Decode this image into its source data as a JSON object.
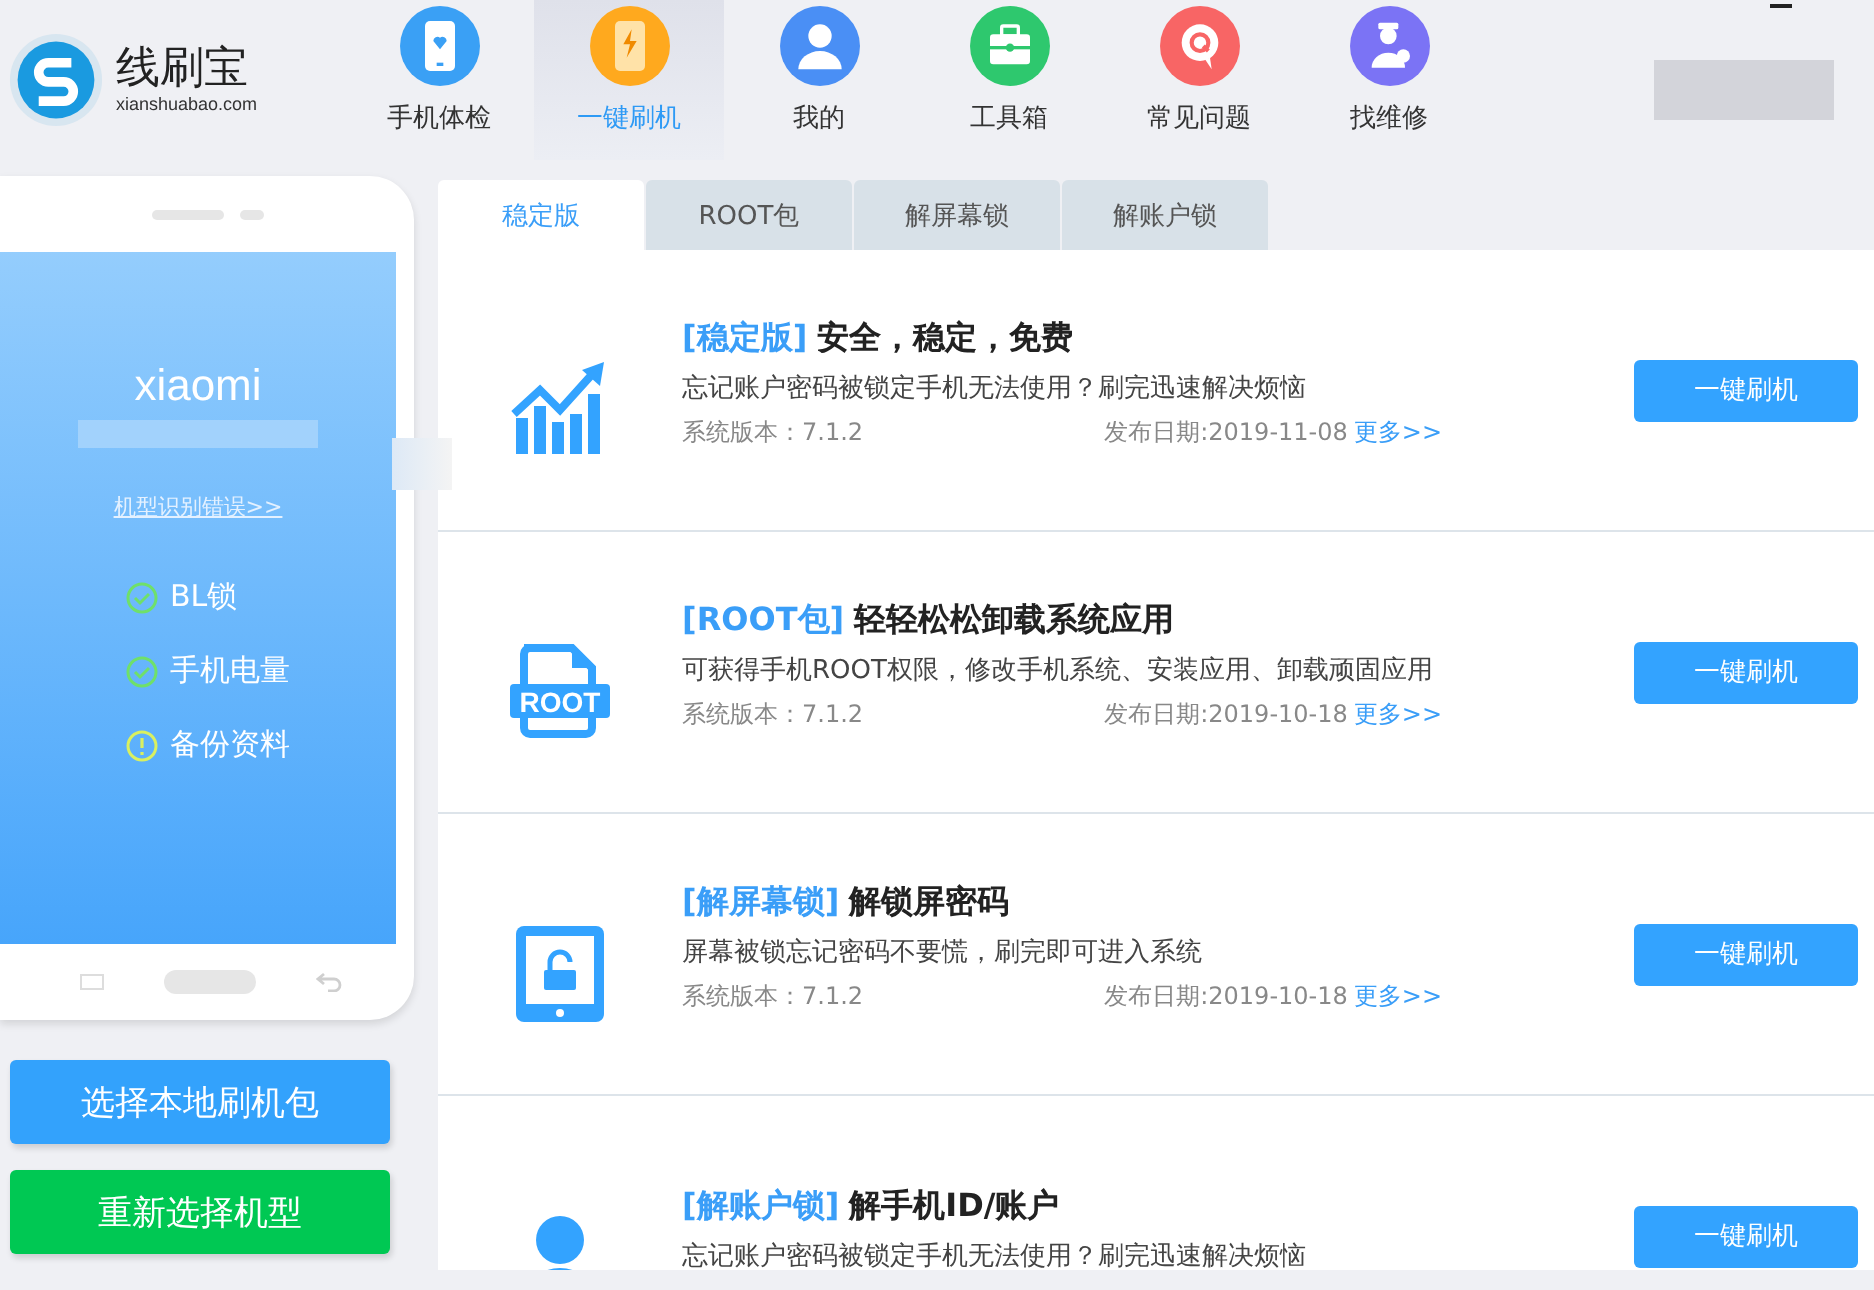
{
  "app": {
    "name": "线刷宝",
    "domain": "xianshuabao.com"
  },
  "nav": [
    {
      "label": "手机体检",
      "kind": "checkup",
      "selected": false
    },
    {
      "label": "一键刷机",
      "kind": "flash",
      "selected": true
    },
    {
      "label": "我的",
      "kind": "user",
      "selected": false
    },
    {
      "label": "工具箱",
      "kind": "toolbox",
      "selected": false
    },
    {
      "label": "常见问题",
      "kind": "faq",
      "selected": false
    },
    {
      "label": "找维修",
      "kind": "repair",
      "selected": false
    }
  ],
  "device": {
    "brand": "xiaomi",
    "wrong_model_link": "机型识别错误>>",
    "checks": [
      {
        "label": "BL锁",
        "kind": "ok"
      },
      {
        "label": "手机电量",
        "kind": "ok"
      },
      {
        "label": "备份资料",
        "kind": "warn"
      }
    ]
  },
  "side_buttons": [
    {
      "label": "选择本地刷机包",
      "kind": "primary"
    },
    {
      "label": "重新选择机型",
      "kind": "success"
    }
  ],
  "tabs": [
    {
      "label": "稳定版",
      "selected": true
    },
    {
      "label": "ROOT包",
      "selected": false
    },
    {
      "label": "解屏幕锁",
      "selected": false
    },
    {
      "label": "解账户锁",
      "selected": false
    }
  ],
  "packages": [
    {
      "kind": "chart",
      "tag": "[稳定版]",
      "title": "安全，稳定，免费",
      "description": "忘记账户密码被锁定手机无法使用？刷完迅速解决烦恼",
      "version": "系统版本：7.1.2",
      "date": "发布日期:2019-11-08",
      "more": "更多>>",
      "button": "一键刷机"
    },
    {
      "kind": "root",
      "tag": "[ROOT包]",
      "title": "轻轻松松卸载系统应用",
      "description": "可获得手机ROOT权限，修改手机系统、安装应用、卸载顽固应用",
      "version": "系统版本：7.1.2",
      "date": "发布日期:2019-10-18",
      "more": "更多>>",
      "button": "一键刷机",
      "icon_text": "ROOT"
    },
    {
      "kind": "screen",
      "tag": "[解屏幕锁]",
      "title": "解锁屏密码",
      "description": "屏幕被锁忘记密码不要慌，刷完即可进入系统",
      "version": "系统版本：7.1.2",
      "date": "发布日期:2019-10-18",
      "more": "更多>>",
      "button": "一键刷机"
    },
    {
      "kind": "account",
      "tag": "[解账户锁]",
      "title": "解手机ID/账户",
      "description": "忘记账户密码被锁定手机无法使用？刷完迅速解决烦恼",
      "button": "一键刷机"
    }
  ]
}
